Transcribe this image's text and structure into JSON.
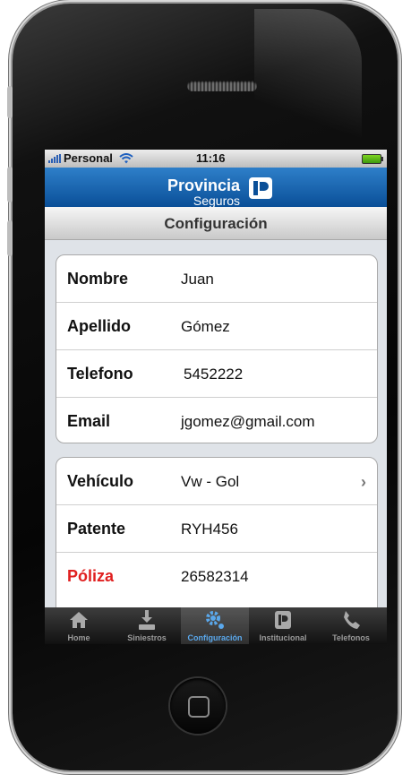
{
  "status_bar": {
    "carrier": "Personal",
    "time": "11:16",
    "icons": [
      "signal-icon",
      "wifi-icon",
      "battery-icon"
    ]
  },
  "brand": {
    "name_line1": "Provincia",
    "name_line2": "Seguros",
    "logo": "provincia-seguros-logo"
  },
  "header": {
    "title": "Configuración"
  },
  "personal_info": [
    {
      "label": "Nombre",
      "value": "Juan"
    },
    {
      "label": "Apellido",
      "value": "Gómez"
    },
    {
      "label": "Telefono",
      "value": "5452222"
    },
    {
      "label": "Email",
      "value": "jgomez@gmail.com"
    }
  ],
  "vehicle_info": [
    {
      "label": "Vehículo",
      "value": "Vw - Gol",
      "chevron": "chevron-right-icon"
    },
    {
      "label": "Patente",
      "value": "RYH456"
    },
    {
      "label": "Póliza",
      "value": "26582314",
      "label_color": "#e02020"
    }
  ],
  "tab_bar": [
    {
      "label": "Home",
      "icon": "home-icon"
    },
    {
      "label": "Siniestros",
      "icon": "download-tray-icon"
    },
    {
      "label": "Configuración",
      "icon": "gear-icon",
      "active": true
    },
    {
      "label": "Institucional",
      "icon": "provincia-logo-icon"
    },
    {
      "label": "Telefonos",
      "icon": "phone-icon"
    }
  ],
  "colors": {
    "brand_blue": "#0a4f98",
    "active_tab": "#5aa8ec",
    "poliza_label": "#e02020"
  }
}
